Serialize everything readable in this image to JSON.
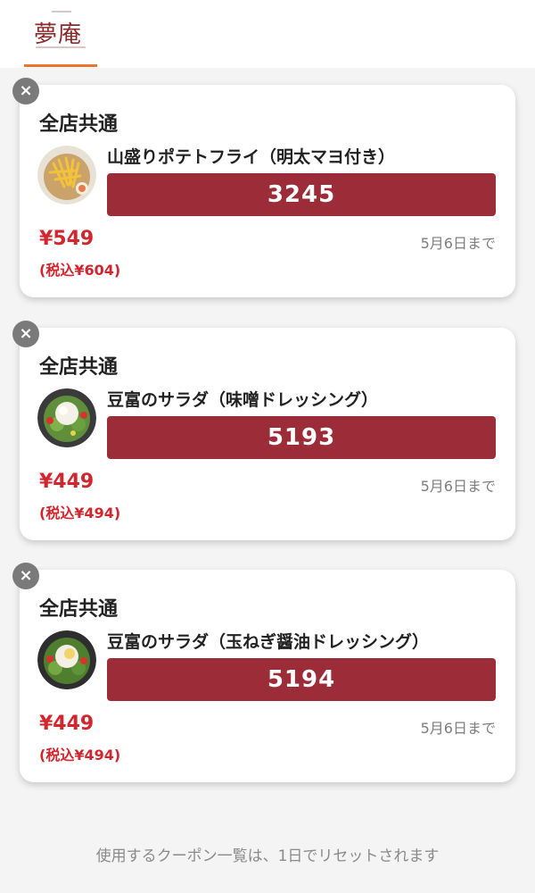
{
  "header": {
    "logo_text": "夢庵"
  },
  "coupons": [
    {
      "scope": "全店共通",
      "item": "山盛りポテトフライ（明太マヨ付き）",
      "code": "3245",
      "price": "¥549",
      "tax_price": "(税込¥604)",
      "expiry": "5月6日まで",
      "image": "fries-icon"
    },
    {
      "scope": "全店共通",
      "item": "豆富のサラダ（味噌ドレッシング）",
      "code": "5193",
      "price": "¥449",
      "tax_price": "(税込¥494)",
      "expiry": "5月6日まで",
      "image": "salad-icon"
    },
    {
      "scope": "全店共通",
      "item": "豆富のサラダ（玉ねぎ醤油ドレッシング）",
      "code": "5194",
      "price": "¥449",
      "tax_price": "(税込¥494)",
      "expiry": "5月6日まで",
      "image": "salad-icon"
    }
  ],
  "close_glyph": "×",
  "footer_note": "使用するクーポン一覧は、1日でリセットされます",
  "colors": {
    "accent_red": "#9c2c37",
    "price_red": "#d2262f",
    "tab_orange": "#e8772e"
  }
}
